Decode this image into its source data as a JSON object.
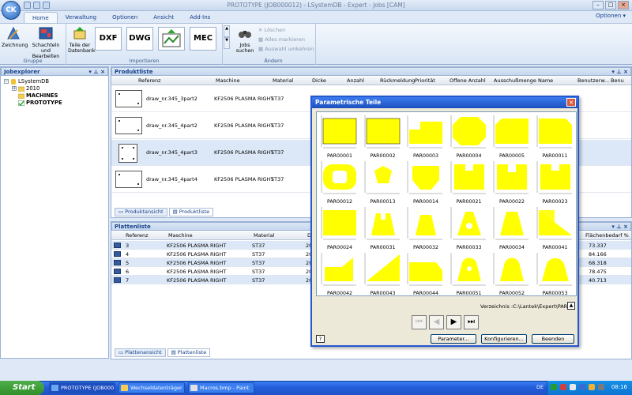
{
  "window": {
    "title": "PROTOTYPE (JOB000012) - LSystemDB - Expert - Jobs [CAM]"
  },
  "app_button": "CK",
  "ribbon": {
    "tabs": [
      "Home",
      "Verwaltung",
      "Optionen",
      "Ansicht",
      "Add-Ins"
    ],
    "optionen_label": "Optionen ▾",
    "groups": {
      "gruppe": {
        "label": "Gruppe",
        "btn1": "Zeichnung",
        "btn2a": "Schachteln und",
        "btn2b": "Bearbeiten"
      },
      "importieren": {
        "label": "Importieren",
        "teile_a": "Teile der",
        "teile_b": "Datenbank",
        "dxf": "DXF",
        "dwg": "DWG",
        "mec": "MEC"
      },
      "aendern": {
        "label": "Ändern",
        "jobs_a": "Jobs",
        "jobs_b": "suchen",
        "loeschen": "Löschen",
        "alles": "Alles markieren",
        "auswahl": "Auswahl umkehren"
      }
    }
  },
  "jobexplorer": {
    "title": "Jobexplorer",
    "tree": [
      {
        "label": "LSystemDB",
        "level": 0,
        "expander": "−"
      },
      {
        "label": "2010",
        "level": 1,
        "expander": "+"
      },
      {
        "label": "MACHINES",
        "level": 1,
        "expander": ""
      },
      {
        "label": "PROTOTYPE",
        "level": 1,
        "expander": ""
      }
    ]
  },
  "produktliste": {
    "title": "Produktliste",
    "columns": [
      "Referenz",
      "Maschine",
      "Material",
      "Dicke",
      "Anzahl",
      "Rückmeldung",
      "Priorität",
      "Offene Anzahl",
      "Ausschußmenge",
      "Name",
      "Benutzerw...",
      "Benu"
    ],
    "rows": [
      {
        "ref": "draw_nr.345_3part2",
        "maschine": "KF2506 PLASMA RIGHT",
        "material": "ST37"
      },
      {
        "ref": "draw_nr.345_4part2",
        "maschine": "KF2506 PLASMA RIGHT",
        "material": "ST37"
      },
      {
        "ref": "draw_nr.345_4part3",
        "maschine": "KF2506 PLASMA RIGHT",
        "material": "ST37"
      },
      {
        "ref": "draw_nr.345_4part4",
        "maschine": "KF2506 PLASMA RIGHT",
        "material": "ST37"
      }
    ],
    "tab_produktansicht": "Produktansicht",
    "tab_produktliste": "Produktliste"
  },
  "plattenliste": {
    "title": "Plattenliste",
    "columns": [
      "Referenz",
      "Maschine",
      "Material",
      "D",
      "Flächenbedarf %"
    ],
    "rows": [
      {
        "ref": "3",
        "maschine": "KF2506 PLASMA RIGHT",
        "material": "ST37",
        "d": "20",
        "flaeche": "73.337"
      },
      {
        "ref": "4",
        "maschine": "KF2506 PLASMA RIGHT",
        "material": "ST37",
        "d": "20",
        "flaeche": "84.166"
      },
      {
        "ref": "5",
        "maschine": "KF2506 PLASMA RIGHT",
        "material": "ST37",
        "d": "20",
        "flaeche": "68.318"
      },
      {
        "ref": "6",
        "maschine": "KF2506 PLASMA RIGHT",
        "material": "ST37",
        "d": "20",
        "flaeche": "78.475"
      },
      {
        "ref": "7",
        "maschine": "KF2506 PLASMA RIGHT",
        "material": "ST37",
        "d": "20",
        "flaeche": "40.713"
      }
    ],
    "tab_plattenansicht": "Plattenansicht",
    "tab_plattenliste": "Plattenliste"
  },
  "dialog": {
    "title": "Parametrische Teile",
    "parts": [
      "PAR00001",
      "PAR00002",
      "PAR00003",
      "PAR00004",
      "PAR00005",
      "PAR00011",
      "PAR00012",
      "PAR00013",
      "PAR00014",
      "PAR00021",
      "PAR00022",
      "PAR00023",
      "PAR00024",
      "PAR00031",
      "PAR00032",
      "PAR00033",
      "PAR00034",
      "PAR00041",
      "PAR00042",
      "PAR00043",
      "PAR00044",
      "PAR00051",
      "PAR00052",
      "PAR00053"
    ],
    "verzeichnis": "Verzeichnis :C:\\Lantek\\Expert\\PARAM",
    "btn_parameter": "Parameter...",
    "btn_konfigurieren": "Konfigurieren...",
    "btn_beenden": "Beenden",
    "help": "?",
    "shape_color": "#ffff00"
  },
  "taskbar": {
    "start": "Start",
    "tasks": [
      "PROTOTYPE (JOB000...",
      "Wechseldatenträger ...",
      "Macros.bmp - Paint"
    ],
    "lang": "DE",
    "clock": "08:16"
  }
}
